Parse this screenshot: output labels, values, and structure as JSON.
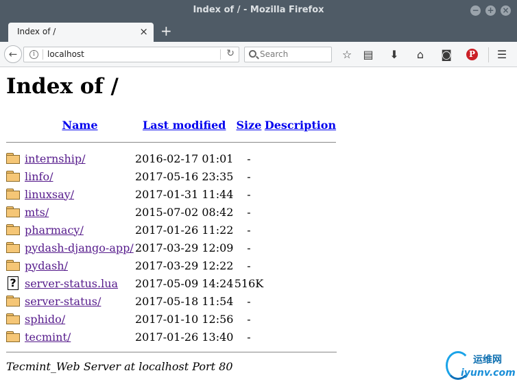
{
  "window": {
    "title": "Index of / - Mozilla Firefox"
  },
  "tab": {
    "label": "Index of /"
  },
  "nav": {
    "url": "localhost",
    "search_placeholder": "Search"
  },
  "page": {
    "heading": "Index of /",
    "columns": {
      "name": "Name",
      "last_modified": "Last modified",
      "size": "Size",
      "description": "Description"
    },
    "entries": [
      {
        "name": "internship/",
        "modified": "2016-02-17 01:01",
        "size": "-",
        "type": "folder"
      },
      {
        "name": "linfo/",
        "modified": "2017-05-16 23:35",
        "size": "-",
        "type": "folder"
      },
      {
        "name": "linuxsay/",
        "modified": "2017-01-31 11:44",
        "size": "-",
        "type": "folder"
      },
      {
        "name": "mts/",
        "modified": "2015-07-02 08:42",
        "size": "-",
        "type": "folder"
      },
      {
        "name": "pharmacy/",
        "modified": "2017-01-26 11:22",
        "size": "-",
        "type": "folder"
      },
      {
        "name": "pydash-django-app/",
        "modified": "2017-03-29 12:09",
        "size": "-",
        "type": "folder"
      },
      {
        "name": "pydash/",
        "modified": "2017-03-29 12:22",
        "size": "-",
        "type": "folder"
      },
      {
        "name": "server-status.lua",
        "modified": "2017-05-09 14:24",
        "size": "516K",
        "type": "unknown"
      },
      {
        "name": "server-status/",
        "modified": "2017-05-18 11:54",
        "size": "-",
        "type": "folder"
      },
      {
        "name": "sphido/",
        "modified": "2017-01-10 12:56",
        "size": "-",
        "type": "folder"
      },
      {
        "name": "tecmint/",
        "modified": "2017-01-26 13:40",
        "size": "-",
        "type": "folder"
      }
    ],
    "address": "Tecmint_Web Server at localhost Port 80"
  },
  "watermark": {
    "cn": "运维网",
    "en": "iyunv.com"
  },
  "colors": {
    "titlebar": "#4f5b66",
    "link_visited": "#551a8b",
    "link": "#0000ee",
    "pinterest": "#cb2027"
  }
}
